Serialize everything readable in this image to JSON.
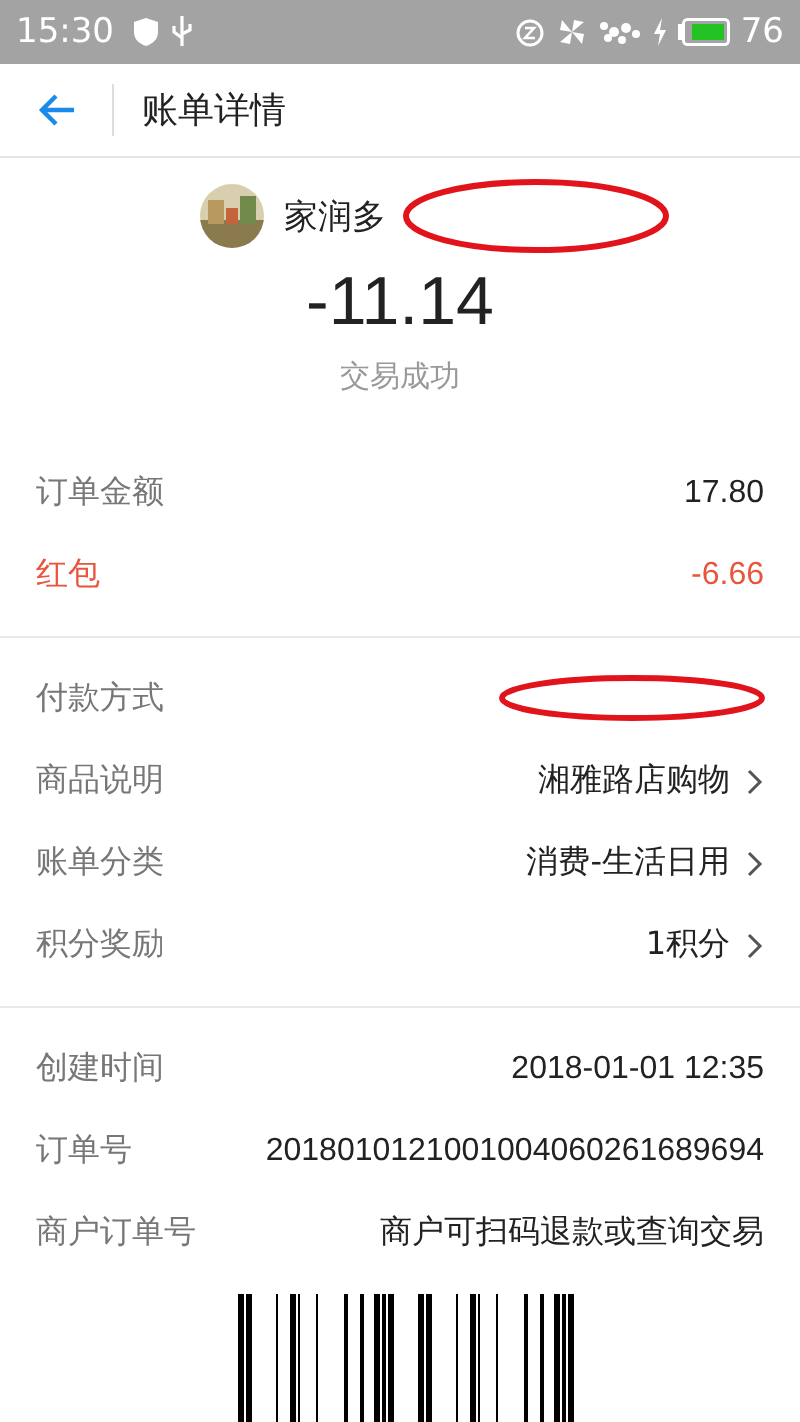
{
  "status_bar": {
    "time": "15:30",
    "battery_text": "76"
  },
  "header": {
    "title": "账单详情"
  },
  "merchant": {
    "name": "家润多",
    "redacted": true
  },
  "amount": "-11.14",
  "status": "交易成功",
  "sections": [
    [
      {
        "label": "订单金额",
        "value": "17.80",
        "kind": "plain"
      },
      {
        "label": "红包",
        "value": "-6.66",
        "kind": "plain",
        "color": "#e8543c"
      }
    ],
    [
      {
        "label": "付款方式",
        "redacted": true
      },
      {
        "label": "商品说明",
        "value": "湘雅路店购物",
        "kind": "link"
      },
      {
        "label": "账单分类",
        "value": "消费-生活日用",
        "kind": "link"
      },
      {
        "label": "积分奖励",
        "value": "1积分",
        "kind": "link"
      }
    ],
    [
      {
        "label": "创建时间",
        "value": "2018-01-01  12:35",
        "kind": "plain"
      },
      {
        "label": "订单号",
        "value": "2018010121001004060261689694",
        "kind": "plain"
      },
      {
        "label": "商户订单号",
        "value": "商户可扫码退款或查询交易",
        "kind": "plain"
      }
    ]
  ],
  "barcode": {
    "kind": "barcode"
  }
}
